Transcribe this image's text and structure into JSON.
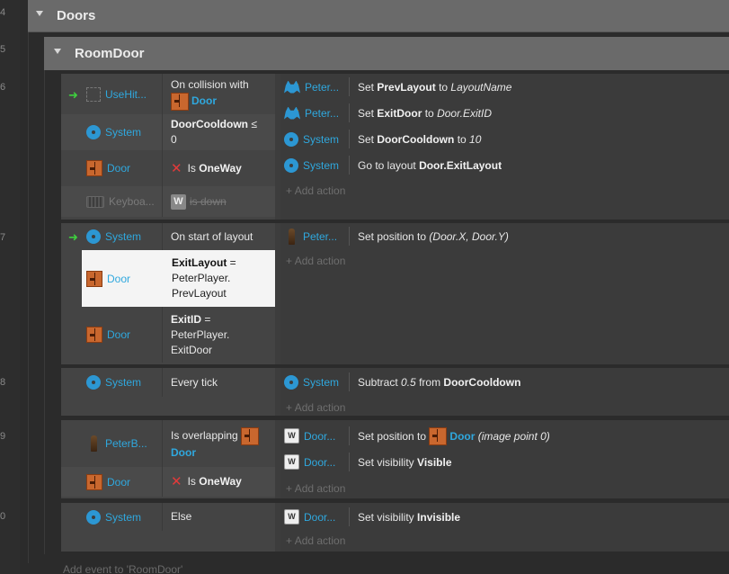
{
  "gutter": {
    "line_numbers": [
      "4",
      "5",
      "6",
      "7",
      "8",
      "9",
      "0"
    ]
  },
  "groups": {
    "doors": "Doors",
    "room_door": "RoomDoor"
  },
  "labels": {
    "add_action": "Add action",
    "add_event": "Add event to 'RoomDoor'"
  },
  "events": {
    "e6": {
      "conditions": [
        {
          "object": "UseHit...",
          "text": "On collision with",
          "target": "Door"
        },
        {
          "object": "System",
          "var": "DoorCooldown",
          "op": " ≤",
          "value": "0"
        },
        {
          "object": "Door",
          "prefix": "Is",
          "var": "OneWay"
        },
        {
          "object": "Keyboa...",
          "text": "is down",
          "key": "W"
        }
      ],
      "actions": [
        {
          "object": "Peter...",
          "pre": "Set",
          "var": "PrevLayout",
          "mid": "to",
          "val": "LayoutName"
        },
        {
          "object": "Peter...",
          "pre": "Set",
          "var": "ExitDoor",
          "mid": "to",
          "val": "Door.ExitID"
        },
        {
          "object": "System",
          "pre": "Set",
          "var": "DoorCooldown",
          "mid": "to",
          "val": "10"
        },
        {
          "object": "System",
          "pre": "Go to layout",
          "var": "Door.ExitLayout"
        }
      ]
    },
    "e7": {
      "conditions": [
        {
          "object": "System",
          "text": "On start of layout"
        },
        {
          "object": "Door",
          "var": "ExitLayout",
          "op": " =",
          "line2": "PeterPlayer.",
          "line3": "PrevLayout"
        },
        {
          "object": "Door",
          "var": "ExitID",
          "op": " =",
          "line2": "PeterPlayer.",
          "line3": "ExitDoor"
        }
      ],
      "actions": [
        {
          "object": "Peter...",
          "pre": "Set position to",
          "val": "(Door.X, Door.Y)"
        }
      ]
    },
    "e8": {
      "conditions": [
        {
          "object": "System",
          "text": "Every tick"
        }
      ],
      "actions": [
        {
          "object": "System",
          "pre": "Subtract",
          "val": "0.5",
          "mid": "from",
          "var": "DoorCooldown"
        }
      ]
    },
    "e9": {
      "conditions": [
        {
          "object": "PeterB...",
          "text": "Is overlapping",
          "target": "Door"
        },
        {
          "object": "Door",
          "prefix": "Is",
          "var": "OneWay"
        }
      ],
      "actions": [
        {
          "object": "Door...",
          "pre": "Set position to",
          "target": "Door",
          "val": "(image point 0)"
        },
        {
          "object": "Door...",
          "pre": "Set visibility",
          "var": "Visible"
        }
      ]
    },
    "e10": {
      "conditions": [
        {
          "object": "System",
          "text": "Else"
        }
      ],
      "actions": [
        {
          "object": "Door...",
          "pre": "Set visibility",
          "var": "Invisible"
        }
      ]
    }
  }
}
